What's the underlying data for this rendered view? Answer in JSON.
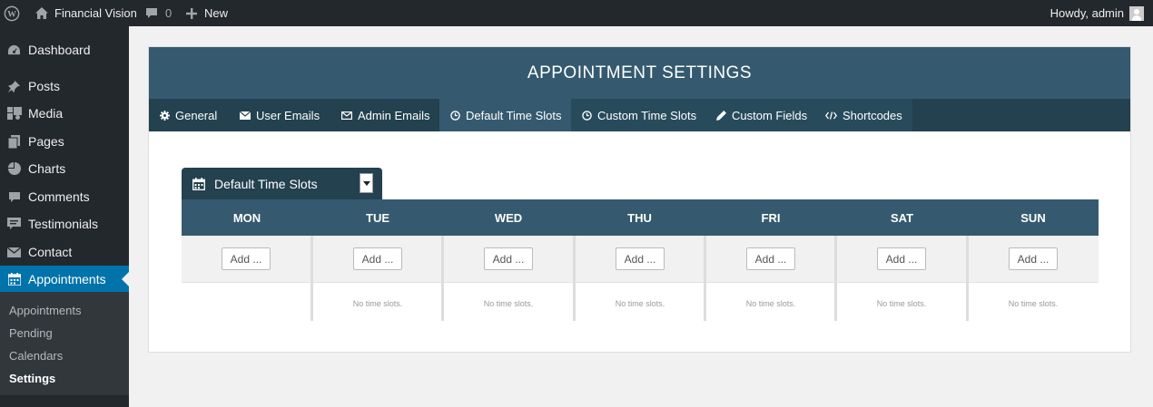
{
  "admin_bar": {
    "site_name": "Financial Vision",
    "comments_count": "0",
    "new_label": "New",
    "howdy": "Howdy, admin"
  },
  "sidebar": {
    "items": [
      {
        "label": "Dashboard",
        "icon": "dashboard-icon"
      },
      {
        "label": "Posts",
        "icon": "pin-icon"
      },
      {
        "label": "Media",
        "icon": "media-icon"
      },
      {
        "label": "Pages",
        "icon": "pages-icon"
      },
      {
        "label": "Charts",
        "icon": "pie-chart-icon"
      },
      {
        "label": "Comments",
        "icon": "comment-icon"
      },
      {
        "label": "Testimonials",
        "icon": "testimonial-icon"
      },
      {
        "label": "Contact",
        "icon": "mail-icon"
      },
      {
        "label": "Appointments",
        "icon": "calendar-icon"
      }
    ],
    "submenu": [
      "Appointments",
      "Pending",
      "Calendars",
      "Settings"
    ]
  },
  "panel": {
    "title": "APPOINTMENT SETTINGS",
    "tabs": [
      {
        "label": "General",
        "icon": "gear-icon"
      },
      {
        "label": "User Emails",
        "icon": "envelope-icon"
      },
      {
        "label": "Admin Emails",
        "icon": "envelope-outline-icon"
      },
      {
        "label": "Default Time Slots",
        "icon": "clock-icon"
      },
      {
        "label": "Custom Time Slots",
        "icon": "clock-icon"
      },
      {
        "label": "Custom Fields",
        "icon": "pencil-icon"
      },
      {
        "label": "Shortcodes",
        "icon": "code-icon"
      }
    ],
    "active_tab": "Default Time Slots"
  },
  "slots": {
    "selected": "Default Time Slots",
    "days": [
      "MON",
      "TUE",
      "WED",
      "THU",
      "FRI",
      "SAT",
      "SUN"
    ],
    "add_label": "Add ...",
    "empty_text": "No time slots."
  },
  "colors": {
    "admin_bar": "#23282d",
    "accent": "#0073aa",
    "panel_header": "#355a6f",
    "tab_bar": "#23414f"
  }
}
